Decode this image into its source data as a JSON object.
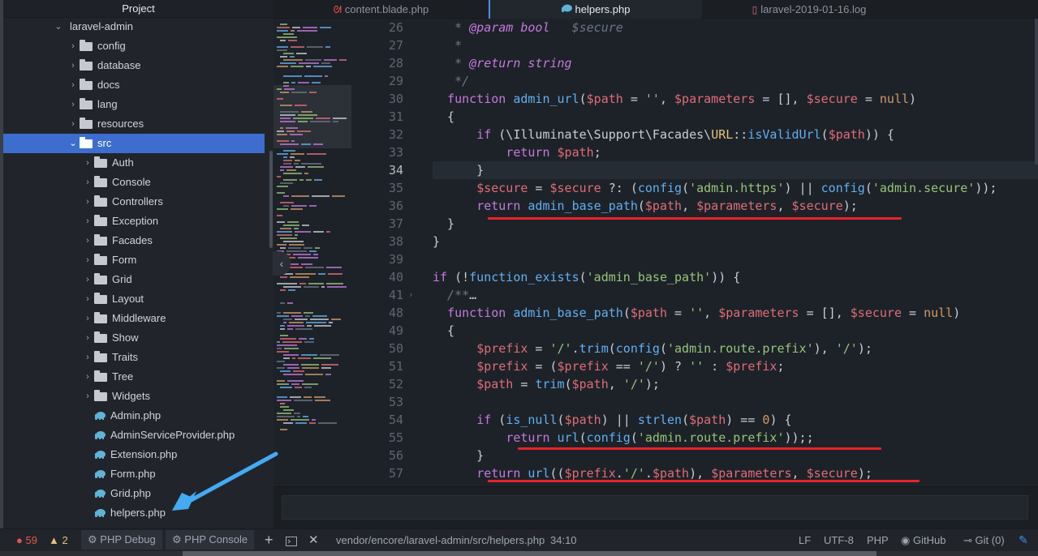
{
  "project_panel": {
    "title": "Project",
    "root": "laravel-admin",
    "folders": [
      "config",
      "database",
      "docs",
      "lang",
      "resources"
    ],
    "selected_folder": "src",
    "src_children": [
      "Auth",
      "Console",
      "Controllers",
      "Exception",
      "Facades",
      "Form",
      "Grid",
      "Layout",
      "Middleware",
      "Show",
      "Traits",
      "Tree",
      "Widgets"
    ],
    "src_files": [
      "Admin.php",
      "AdminServiceProvider.php",
      "Extension.php",
      "Form.php",
      "Grid.php",
      "helpers.php"
    ]
  },
  "tabs": [
    {
      "label": "content.blade.php",
      "icon": "laravel-icon",
      "color": "#f05340"
    },
    {
      "label": "helpers.php",
      "icon": "php-elephant-icon",
      "color": "#5fb3d6",
      "active": true
    },
    {
      "label": "laravel-2019-01-16.log",
      "icon": "document-icon",
      "color": "#e06c75"
    }
  ],
  "editor": {
    "current_line": "34",
    "lines": [
      {
        "n": "26",
        "code": [
          [
            "c",
            "   * "
          ],
          [
            "ct",
            "@param"
          ],
          [
            "c",
            " "
          ],
          [
            "ct",
            "bool"
          ],
          [
            "c",
            "   $secure"
          ]
        ]
      },
      {
        "n": "27",
        "code": [
          [
            "c",
            "   *"
          ]
        ]
      },
      {
        "n": "28",
        "code": [
          [
            "c",
            "   * "
          ],
          [
            "ct",
            "@return"
          ],
          [
            "c",
            " "
          ],
          [
            "ct",
            "string"
          ]
        ]
      },
      {
        "n": "29",
        "code": [
          [
            "c",
            "   */"
          ]
        ]
      },
      {
        "n": "30",
        "code": [
          [
            "p",
            "  "
          ],
          [
            "k",
            "function"
          ],
          [
            "p",
            " "
          ],
          [
            "f",
            "admin_url"
          ],
          [
            "p",
            "("
          ],
          [
            "v",
            "$path"
          ],
          [
            "p",
            " = "
          ],
          [
            "s",
            "''"
          ],
          [
            "p",
            ", "
          ],
          [
            "v",
            "$parameters"
          ],
          [
            "p",
            " = [], "
          ],
          [
            "v",
            "$secure"
          ],
          [
            "p",
            " = "
          ],
          [
            "n",
            "null"
          ],
          [
            "p",
            ")"
          ]
        ]
      },
      {
        "n": "31",
        "code": [
          [
            "p",
            "  {"
          ]
        ]
      },
      {
        "n": "32",
        "code": [
          [
            "p",
            "      "
          ],
          [
            "k",
            "if"
          ],
          [
            "p",
            " (\\Illuminate\\Support\\Facades\\"
          ],
          [
            "cn",
            "URL"
          ],
          [
            "p",
            "::"
          ],
          [
            "f",
            "isValidUrl"
          ],
          [
            "p",
            "("
          ],
          [
            "v",
            "$path"
          ],
          [
            "p",
            ")) {"
          ]
        ]
      },
      {
        "n": "33",
        "code": [
          [
            "p",
            "          "
          ],
          [
            "k",
            "return"
          ],
          [
            "p",
            " "
          ],
          [
            "v",
            "$path"
          ],
          [
            "p",
            ";"
          ]
        ]
      },
      {
        "n": "34",
        "code": [
          [
            "p",
            "      }"
          ]
        ]
      },
      {
        "n": "35",
        "code": [
          [
            "p",
            "      "
          ],
          [
            "v",
            "$secure"
          ],
          [
            "p",
            " = "
          ],
          [
            "v",
            "$secure"
          ],
          [
            "p",
            " ?: ("
          ],
          [
            "f",
            "config"
          ],
          [
            "p",
            "("
          ],
          [
            "s",
            "'admin.https'"
          ],
          [
            "p",
            ") || "
          ],
          [
            "f",
            "config"
          ],
          [
            "p",
            "("
          ],
          [
            "s",
            "'admin.secure'"
          ],
          [
            "p",
            "));"
          ]
        ]
      },
      {
        "n": "36",
        "code": [
          [
            "p",
            "      "
          ],
          [
            "k",
            "return"
          ],
          [
            "p",
            " "
          ],
          [
            "f",
            "admin_base_path"
          ],
          [
            "p",
            "("
          ],
          [
            "v",
            "$path"
          ],
          [
            "p",
            ", "
          ],
          [
            "v",
            "$parameters"
          ],
          [
            "p",
            ", "
          ],
          [
            "v",
            "$secure"
          ],
          [
            "p",
            ");"
          ]
        ]
      },
      {
        "n": "37",
        "code": [
          [
            "p",
            "  }"
          ]
        ]
      },
      {
        "n": "38",
        "code": [
          [
            "p",
            "}"
          ]
        ]
      },
      {
        "n": "39",
        "code": []
      },
      {
        "n": "40",
        "code": [
          [
            "k",
            "if"
          ],
          [
            "p",
            " (!"
          ],
          [
            "f",
            "function_exists"
          ],
          [
            "p",
            "("
          ],
          [
            "s",
            "'admin_base_path'"
          ],
          [
            "p",
            ")) {"
          ]
        ]
      },
      {
        "n": "41",
        "code": [
          [
            "c",
            "  /**"
          ],
          [
            "p",
            "…"
          ]
        ]
      },
      {
        "n": "48",
        "code": [
          [
            "p",
            "  "
          ],
          [
            "k",
            "function"
          ],
          [
            "p",
            " "
          ],
          [
            "f",
            "admin_base_path"
          ],
          [
            "p",
            "("
          ],
          [
            "v",
            "$path"
          ],
          [
            "p",
            " = "
          ],
          [
            "s",
            "''"
          ],
          [
            "p",
            ", "
          ],
          [
            "v",
            "$parameters"
          ],
          [
            "p",
            " = [], "
          ],
          [
            "v",
            "$secure"
          ],
          [
            "p",
            " = "
          ],
          [
            "n",
            "null"
          ],
          [
            "p",
            ")"
          ]
        ]
      },
      {
        "n": "49",
        "code": [
          [
            "p",
            "  {"
          ]
        ]
      },
      {
        "n": "50",
        "code": [
          [
            "p",
            "      "
          ],
          [
            "v",
            "$prefix"
          ],
          [
            "p",
            " = "
          ],
          [
            "s",
            "'/'"
          ],
          [
            "p",
            "."
          ],
          [
            "f",
            "trim"
          ],
          [
            "p",
            "("
          ],
          [
            "f",
            "config"
          ],
          [
            "p",
            "("
          ],
          [
            "s",
            "'admin.route.prefix'"
          ],
          [
            "p",
            "), "
          ],
          [
            "s",
            "'/'"
          ],
          [
            "p",
            ");"
          ]
        ]
      },
      {
        "n": "51",
        "code": [
          [
            "p",
            "      "
          ],
          [
            "v",
            "$prefix"
          ],
          [
            "p",
            " = ("
          ],
          [
            "v",
            "$prefix"
          ],
          [
            "p",
            " == "
          ],
          [
            "s",
            "'/'"
          ],
          [
            "p",
            ") ? "
          ],
          [
            "s",
            "''"
          ],
          [
            "p",
            " : "
          ],
          [
            "v",
            "$prefix"
          ],
          [
            "p",
            ";"
          ]
        ]
      },
      {
        "n": "52",
        "code": [
          [
            "p",
            "      "
          ],
          [
            "v",
            "$path"
          ],
          [
            "p",
            " = "
          ],
          [
            "f",
            "trim"
          ],
          [
            "p",
            "("
          ],
          [
            "v",
            "$path"
          ],
          [
            "p",
            ", "
          ],
          [
            "s",
            "'/'"
          ],
          [
            "p",
            ");"
          ]
        ]
      },
      {
        "n": "53",
        "code": []
      },
      {
        "n": "54",
        "code": [
          [
            "p",
            "      "
          ],
          [
            "k",
            "if"
          ],
          [
            "p",
            " ("
          ],
          [
            "f",
            "is_null"
          ],
          [
            "p",
            "("
          ],
          [
            "v",
            "$path"
          ],
          [
            "p",
            ") || "
          ],
          [
            "f",
            "strlen"
          ],
          [
            "p",
            "("
          ],
          [
            "v",
            "$path"
          ],
          [
            "p",
            ") == "
          ],
          [
            "n",
            "0"
          ],
          [
            "p",
            ") {"
          ]
        ]
      },
      {
        "n": "55",
        "code": [
          [
            "p",
            "          "
          ],
          [
            "k",
            "return"
          ],
          [
            "p",
            " "
          ],
          [
            "f",
            "url"
          ],
          [
            "p",
            "("
          ],
          [
            "f",
            "config"
          ],
          [
            "p",
            "("
          ],
          [
            "s",
            "'admin.route.prefix'"
          ],
          [
            "p",
            "));;"
          ]
        ]
      },
      {
        "n": "56",
        "code": [
          [
            "p",
            "      }"
          ]
        ]
      },
      {
        "n": "57",
        "code": [
          [
            "p",
            "      "
          ],
          [
            "k",
            "return"
          ],
          [
            "p",
            " "
          ],
          [
            "f",
            "url"
          ],
          [
            "p",
            "(("
          ],
          [
            "v",
            "$prefix"
          ],
          [
            "p",
            "."
          ],
          [
            "s",
            "'/'"
          ],
          [
            "p",
            "."
          ],
          [
            "v",
            "$path"
          ],
          [
            "p",
            "), "
          ],
          [
            "v",
            "$parameters"
          ],
          [
            "p",
            ", "
          ],
          [
            "v",
            "$secure"
          ],
          [
            "p",
            ");"
          ]
        ]
      }
    ]
  },
  "status": {
    "errors": "59",
    "warnings": "2",
    "tab_php_debug": "PHP Debug",
    "tab_php_console": "PHP Console",
    "file_path": "vendor/encore/laravel-admin/src/helpers.php",
    "cursor": "34:10",
    "line_ending": "LF",
    "encoding": "UTF-8",
    "grammar": "PHP",
    "github": "GitHub",
    "git": "Git (0)"
  },
  "colors": {
    "accent": "#3d6ecf",
    "underline": "#e8232a",
    "arrow": "#45aaf2",
    "error": "#e45649",
    "warning": "#e5c07b"
  }
}
